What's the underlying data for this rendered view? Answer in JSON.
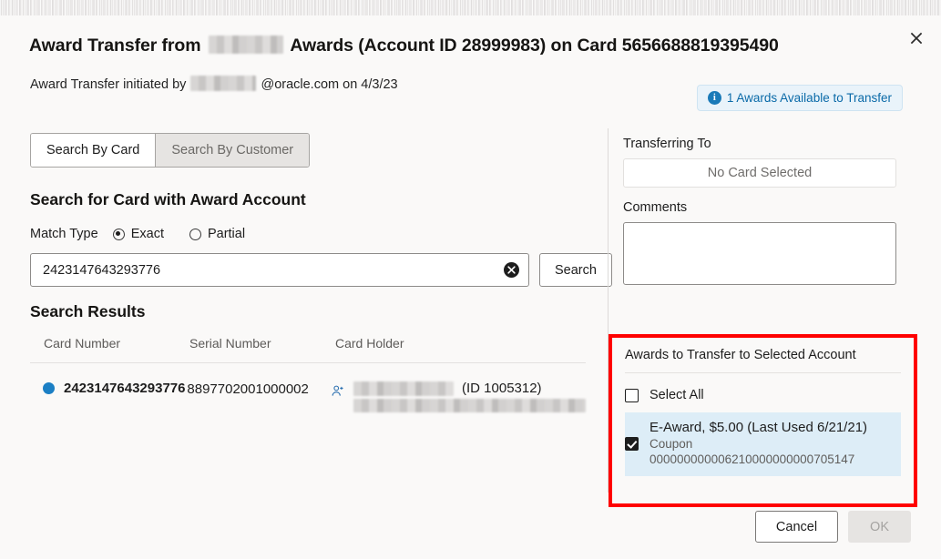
{
  "dialog": {
    "title_prefix": "Award Transfer from",
    "title_suffix": "Awards (Account ID 28999983) on Card 5656688819395490",
    "subtitle_prefix": "Award Transfer initiated by",
    "subtitle_suffix": "@oracle.com on 4/3/23",
    "close_label": "Close",
    "awards_badge": "1 Awards Available to Transfer"
  },
  "tabs": {
    "search_by_card": "Search By Card",
    "search_by_customer": "Search By Customer"
  },
  "search": {
    "heading": "Search for Card with Award Account",
    "match_type_label": "Match Type",
    "option_exact": "Exact",
    "option_partial": "Partial",
    "input_value": "2423147643293776",
    "input_placeholder": "",
    "clear_label": "✕",
    "search_button": "Search"
  },
  "results": {
    "heading": "Search Results",
    "columns": [
      "Card Number",
      "Serial Number",
      "Card Holder"
    ],
    "rows": [
      {
        "card_number": "2423147643293776",
        "serial_number": "8897702001000002",
        "holder_id": "(ID 1005312)"
      }
    ]
  },
  "transfer": {
    "transferring_to_label": "Transferring To",
    "no_card_selected": "No Card Selected",
    "comments_label": "Comments",
    "comments_value": "",
    "comments_placeholder": ""
  },
  "awards": {
    "panel_title": "Awards to Transfer to Selected Account",
    "select_all_label": "Select All",
    "items": [
      {
        "title": "E-Award, $5.00 (Last Used 6/21/21)",
        "type": "Coupon",
        "code": "000000000006210000000000705147",
        "checked": true
      }
    ]
  },
  "footer": {
    "cancel": "Cancel",
    "ok": "OK"
  },
  "colors": {
    "accent_blue": "#1b7fc4",
    "info_blue": "#0a6aa8",
    "highlight_red": "#ff0000",
    "selected_row_bg": "#ddedf7"
  }
}
